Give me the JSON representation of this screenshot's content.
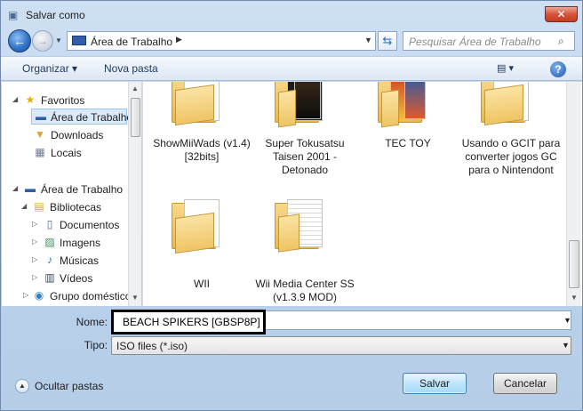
{
  "window": {
    "title": "Salvar como",
    "close_label": "✕"
  },
  "address": {
    "location": "Área de Trabalho",
    "search_placeholder": "Pesquisar Área de Trabalho"
  },
  "toolbar": {
    "organize": "Organizar ▾",
    "new_folder": "Nova pasta",
    "view": "▤ ▾",
    "help": "?"
  },
  "sidebar": {
    "items": [
      {
        "label": "Favoritos",
        "icon": "star-icon"
      },
      {
        "label": "Área de Trabalho",
        "icon": "desktop-icon",
        "selected": true
      },
      {
        "label": "Downloads",
        "icon": "downloads-icon"
      },
      {
        "label": "Locais",
        "icon": "places-icon"
      },
      {
        "label": "Área de Trabalho",
        "icon": "desktop-icon"
      },
      {
        "label": "Bibliotecas",
        "icon": "libraries-icon"
      },
      {
        "label": "Documentos",
        "icon": "documents-icon"
      },
      {
        "label": "Imagens",
        "icon": "images-icon"
      },
      {
        "label": "Músicas",
        "icon": "music-icon"
      },
      {
        "label": "Vídeos",
        "icon": "videos-icon"
      },
      {
        "label": "Grupo doméstico",
        "icon": "homegroup-icon"
      }
    ]
  },
  "files": [
    {
      "name": "ShowMiiWads (v1.4) [32bits]",
      "type": "folder"
    },
    {
      "name": "Super Tokusatsu Taisen 2001 - Detonado",
      "type": "folder"
    },
    {
      "name": "TEC TOY",
      "type": "folder"
    },
    {
      "name": "Usando o GCIT para converter jogos GC para o Nintendont",
      "type": "folder"
    },
    {
      "name": "WII",
      "type": "folder"
    },
    {
      "name": "Wii Media Center SS (v1.3.9 MOD)",
      "type": "folder"
    }
  ],
  "form": {
    "name_label": "Nome:",
    "name_value": "BEACH SPIKERS [GBSP8P]",
    "type_label": "Tipo:",
    "type_value": "ISO files (*.iso)"
  },
  "footer": {
    "hide_folders": "Ocultar pastas",
    "save": "Salvar",
    "cancel": "Cancelar"
  },
  "colors": {
    "accent": "#2d6fc4",
    "folder": "#efc564",
    "selection": "#dbeafb"
  }
}
